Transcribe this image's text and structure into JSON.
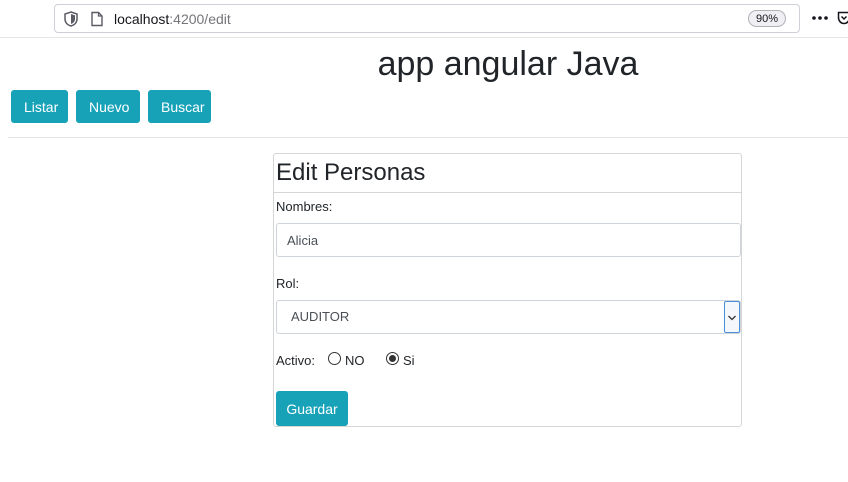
{
  "browser": {
    "url_host": "localhost",
    "url_path": ":4200/edit",
    "zoom": "90%"
  },
  "app": {
    "title": "app angular Java"
  },
  "nav": {
    "listar_label": "Listar",
    "nuevo_label": "Nuevo",
    "buscar_label": "Buscar"
  },
  "form": {
    "title": "Edit Personas",
    "nombres_label": "Nombres:",
    "nombres_value": "Alicia",
    "rol_label": "Rol:",
    "rol_value": "AUDITOR",
    "activo_label": "Activo:",
    "option_no": "NO",
    "option_si": "Si",
    "activo_selected": "Si",
    "submit_label": "Guardar"
  },
  "colors": {
    "accent": "#17a2b8"
  },
  "icons": [
    "shield-icon",
    "page-icon",
    "more-icon",
    "pocket-icon",
    "chevron-down-icon"
  ]
}
